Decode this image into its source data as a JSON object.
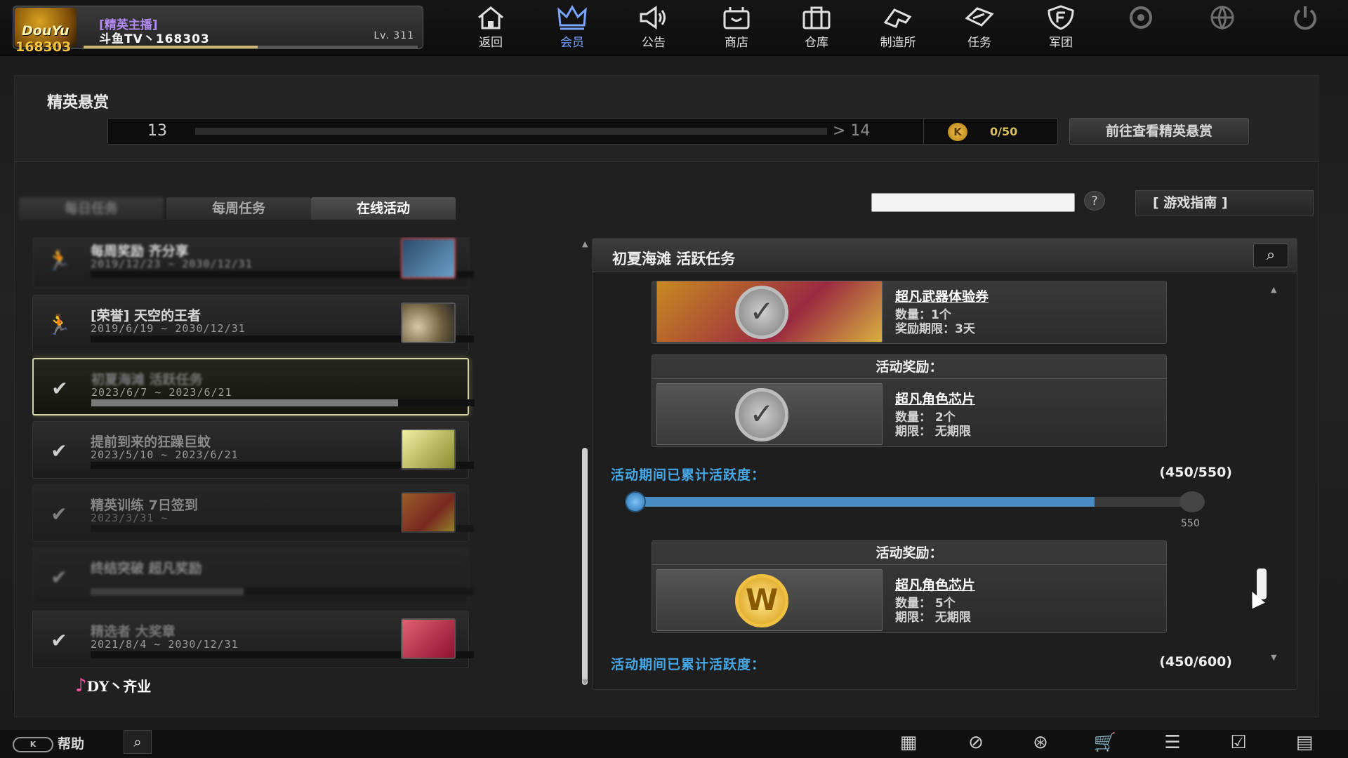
{
  "profile": {
    "logo_text": "DouYu",
    "uid": "168303",
    "rank": "[精英主播]",
    "name": "斗鱼TV丶168303",
    "level": "Lv. 311",
    "xp_fraction": 0.52
  },
  "nav": [
    {
      "label": "返回",
      "icon": "home-icon"
    },
    {
      "label": "会员",
      "icon": "crown-icon"
    },
    {
      "label": "公告",
      "icon": "megaphone-icon"
    },
    {
      "label": "商店",
      "icon": "shop-icon"
    },
    {
      "label": "仓库",
      "icon": "briefcase-icon"
    },
    {
      "label": "制造所",
      "icon": "craft-icon"
    },
    {
      "label": "任务",
      "icon": "mission-icon"
    },
    {
      "label": "军团",
      "icon": "shield-icon"
    },
    {
      "label": "",
      "icon": "settings-icon"
    },
    {
      "label": "",
      "icon": "globe-icon"
    },
    {
      "label": "",
      "icon": "power-icon"
    }
  ],
  "bounty": {
    "title": "精英悬赏",
    "level_from": "13",
    "level_to": "> 14",
    "coins": "0/50",
    "go_button": "前往查看精英悬赏"
  },
  "tabs": [
    "每日任务",
    "每周任务",
    "在线活动"
  ],
  "help_q": "?",
  "guide_button": "[  游戏指南  ]",
  "activities": [
    {
      "title": "每周奖励 齐分享",
      "dates": "2019/12/23 ~ 2030/12/31",
      "progress": 0,
      "icon": "soldier-icon",
      "thumb": "gun-thumb"
    },
    {
      "title": "[荣誉] 天空的王者",
      "dates": "2019/6/19 ~ 2030/12/31",
      "progress": 0,
      "icon": "soldier-icon",
      "thumb": "item-thumb"
    },
    {
      "title": "初夏海滩 活跃任务",
      "dates": "2023/6/7 ~ 2023/6/21",
      "progress": 0.8,
      "icon": "check-icon",
      "thumb": ""
    },
    {
      "title": "提前到来的狂躁巨蚊",
      "dates": "2023/5/10 ~ 2023/6/21",
      "progress": 0,
      "icon": "check-icon",
      "thumb": "card-thumb"
    },
    {
      "title": "精英训练 7日签到",
      "dates": "2023/3/31 ~",
      "progress": 0,
      "icon": "check-icon",
      "thumb": "card-thumb"
    },
    {
      "title": "终结突破 超凡奖励",
      "dates": "",
      "progress": 0.4,
      "icon": "check-icon",
      "thumb": ""
    },
    {
      "title": "精选者 大奖章",
      "dates": "2021/8/4 ~ 2030/12/31",
      "progress": 0,
      "icon": "check-icon",
      "thumb": "card-thumb"
    }
  ],
  "watermark": "DY丶齐业",
  "detail": {
    "title": "初夏海滩  活跃任务",
    "rewards": [
      {
        "header": "",
        "name": "超凡武器体验券",
        "line1": "数量：1个",
        "line2": "奖励期限：3天"
      },
      {
        "header": "活动奖励：",
        "name": "超凡角色芯片",
        "line1": "数量：  2个",
        "line2": "期限：  无期限"
      },
      {
        "header": "活动奖励：",
        "name": "超凡角色芯片",
        "line1": "数量：  5个",
        "line2": "期限：  无期限"
      }
    ],
    "activity_label": "活动期间已累计活跃度：",
    "activity_value_1": "(450/550)",
    "activity_value_2": "(450/600)",
    "slider_max": "550",
    "slider_value": 450
  },
  "bottom": {
    "help_label": "帮助",
    "icons": [
      "calendar-icon",
      "compass-icon",
      "runner-icon",
      "cart-icon",
      "list-icon",
      "checkin-icon",
      "film-icon"
    ]
  }
}
